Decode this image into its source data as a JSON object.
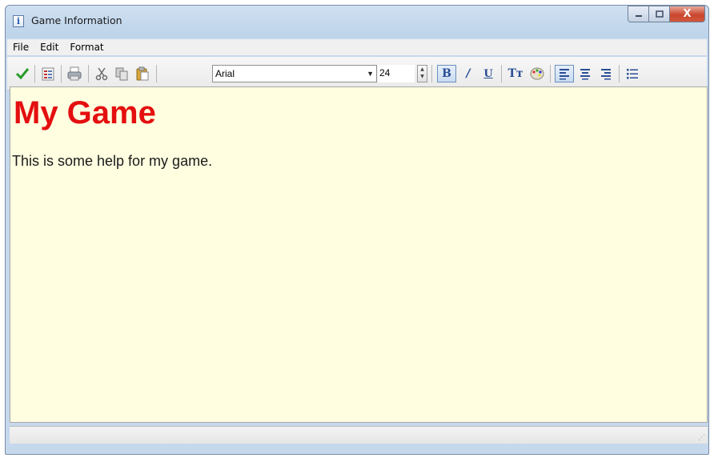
{
  "window": {
    "title": "Game Information"
  },
  "title_buttons": {
    "minimize": "—",
    "maximize": "□",
    "close": "X"
  },
  "menu": [
    {
      "label": "File"
    },
    {
      "label": "Edit"
    },
    {
      "label": "Format"
    }
  ],
  "toolbar": {
    "font_name": "Arial",
    "font_size": "24",
    "bold_label": "B",
    "italic_label": "/",
    "underline_label": "U",
    "font_glyph": "Tт",
    "dropdown_arrow": "▼"
  },
  "document": {
    "heading": "My Game",
    "heading_color": "#e40f0f",
    "body": "This is some help for my game.",
    "background": "#fffee0"
  },
  "icons": {
    "ok": "check-icon",
    "open": "document-list-icon",
    "print": "printer-icon",
    "cut": "scissors-icon",
    "copy": "copy-icon",
    "paste": "paste-icon",
    "font_style": "font-style-icon",
    "color": "palette-icon",
    "align_left": "align-left-icon",
    "align_center": "align-center-icon",
    "align_right": "align-right-icon",
    "bullets": "bullet-list-icon"
  }
}
